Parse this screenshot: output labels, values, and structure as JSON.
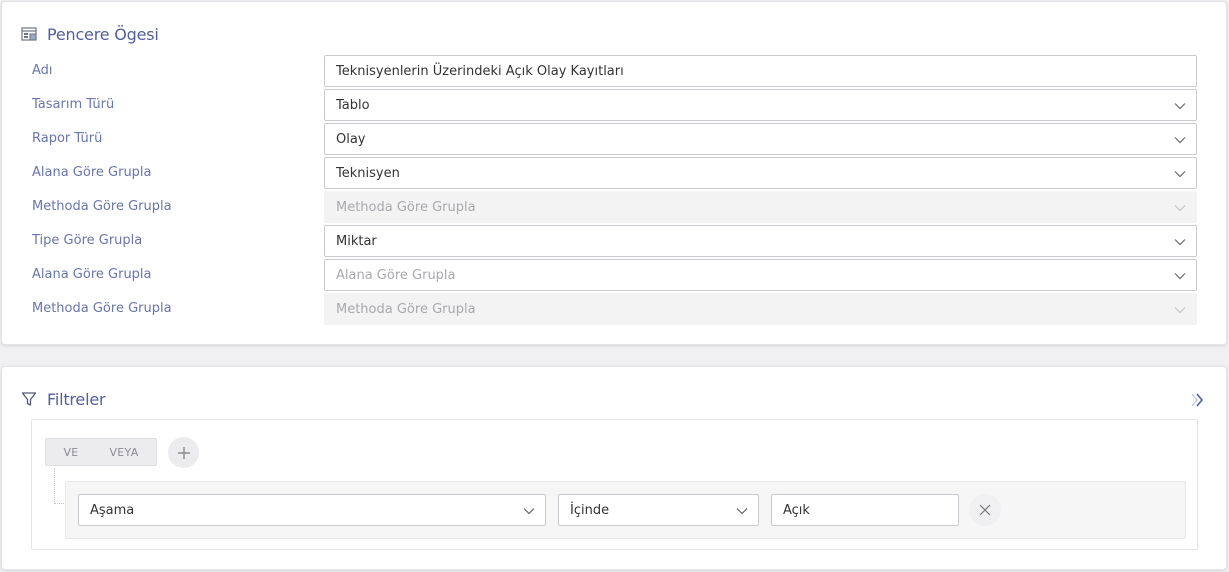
{
  "window_panel": {
    "title": "Pencere Ögesi",
    "icon": "window-layout-icon",
    "fields": [
      {
        "label": "Adı",
        "value": "Teknisyenlerin Üzerindeki Açık Olay Kayıtları",
        "kind": "text"
      },
      {
        "label": "Tasarım Türü",
        "value": "Tablo",
        "kind": "select"
      },
      {
        "label": "Rapor Türü",
        "value": "Olay",
        "kind": "select"
      },
      {
        "label": "Alana Göre Grupla",
        "value": "Teknisyen",
        "kind": "select"
      },
      {
        "label": "Methoda Göre Grupla",
        "value": "Methoda Göre Grupla",
        "kind": "select-disabled"
      },
      {
        "label": "Tipe Göre Grupla",
        "value": "Miktar",
        "kind": "select"
      },
      {
        "label": "Alana Göre Grupla",
        "value": "Alana Göre Grupla",
        "kind": "select-placeholder"
      },
      {
        "label": "Methoda Göre Grupla",
        "value": "Methoda Göre Grupla",
        "kind": "select-disabled"
      }
    ]
  },
  "filters_panel": {
    "title": "Filtreler",
    "icon": "filter-funnel-icon",
    "logic": {
      "and_label": "VE",
      "or_label": "VEYA"
    },
    "rule": {
      "field": "Aşama",
      "operator": "İçinde",
      "value": "Açık"
    }
  },
  "colors": {
    "accent": "#535e9c",
    "label": "#6a75a8",
    "border": "#c9c9cf",
    "disabled_bg": "#f3f3f4"
  }
}
